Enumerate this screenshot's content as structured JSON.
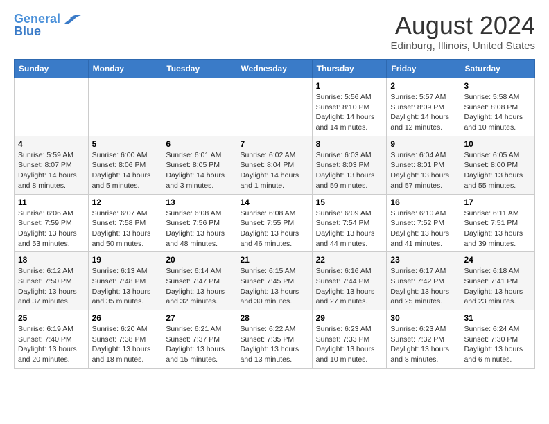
{
  "header": {
    "logo_line1": "General",
    "logo_line2": "Blue",
    "main_title": "August 2024",
    "subtitle": "Edinburg, Illinois, United States"
  },
  "weekdays": [
    "Sunday",
    "Monday",
    "Tuesday",
    "Wednesday",
    "Thursday",
    "Friday",
    "Saturday"
  ],
  "weeks": [
    [
      {
        "day": "",
        "info": ""
      },
      {
        "day": "",
        "info": ""
      },
      {
        "day": "",
        "info": ""
      },
      {
        "day": "",
        "info": ""
      },
      {
        "day": "1",
        "info": "Sunrise: 5:56 AM\nSunset: 8:10 PM\nDaylight: 14 hours\nand 14 minutes."
      },
      {
        "day": "2",
        "info": "Sunrise: 5:57 AM\nSunset: 8:09 PM\nDaylight: 14 hours\nand 12 minutes."
      },
      {
        "day": "3",
        "info": "Sunrise: 5:58 AM\nSunset: 8:08 PM\nDaylight: 14 hours\nand 10 minutes."
      }
    ],
    [
      {
        "day": "4",
        "info": "Sunrise: 5:59 AM\nSunset: 8:07 PM\nDaylight: 14 hours\nand 8 minutes."
      },
      {
        "day": "5",
        "info": "Sunrise: 6:00 AM\nSunset: 8:06 PM\nDaylight: 14 hours\nand 5 minutes."
      },
      {
        "day": "6",
        "info": "Sunrise: 6:01 AM\nSunset: 8:05 PM\nDaylight: 14 hours\nand 3 minutes."
      },
      {
        "day": "7",
        "info": "Sunrise: 6:02 AM\nSunset: 8:04 PM\nDaylight: 14 hours\nand 1 minute."
      },
      {
        "day": "8",
        "info": "Sunrise: 6:03 AM\nSunset: 8:03 PM\nDaylight: 13 hours\nand 59 minutes."
      },
      {
        "day": "9",
        "info": "Sunrise: 6:04 AM\nSunset: 8:01 PM\nDaylight: 13 hours\nand 57 minutes."
      },
      {
        "day": "10",
        "info": "Sunrise: 6:05 AM\nSunset: 8:00 PM\nDaylight: 13 hours\nand 55 minutes."
      }
    ],
    [
      {
        "day": "11",
        "info": "Sunrise: 6:06 AM\nSunset: 7:59 PM\nDaylight: 13 hours\nand 53 minutes."
      },
      {
        "day": "12",
        "info": "Sunrise: 6:07 AM\nSunset: 7:58 PM\nDaylight: 13 hours\nand 50 minutes."
      },
      {
        "day": "13",
        "info": "Sunrise: 6:08 AM\nSunset: 7:56 PM\nDaylight: 13 hours\nand 48 minutes."
      },
      {
        "day": "14",
        "info": "Sunrise: 6:08 AM\nSunset: 7:55 PM\nDaylight: 13 hours\nand 46 minutes."
      },
      {
        "day": "15",
        "info": "Sunrise: 6:09 AM\nSunset: 7:54 PM\nDaylight: 13 hours\nand 44 minutes."
      },
      {
        "day": "16",
        "info": "Sunrise: 6:10 AM\nSunset: 7:52 PM\nDaylight: 13 hours\nand 41 minutes."
      },
      {
        "day": "17",
        "info": "Sunrise: 6:11 AM\nSunset: 7:51 PM\nDaylight: 13 hours\nand 39 minutes."
      }
    ],
    [
      {
        "day": "18",
        "info": "Sunrise: 6:12 AM\nSunset: 7:50 PM\nDaylight: 13 hours\nand 37 minutes."
      },
      {
        "day": "19",
        "info": "Sunrise: 6:13 AM\nSunset: 7:48 PM\nDaylight: 13 hours\nand 35 minutes."
      },
      {
        "day": "20",
        "info": "Sunrise: 6:14 AM\nSunset: 7:47 PM\nDaylight: 13 hours\nand 32 minutes."
      },
      {
        "day": "21",
        "info": "Sunrise: 6:15 AM\nSunset: 7:45 PM\nDaylight: 13 hours\nand 30 minutes."
      },
      {
        "day": "22",
        "info": "Sunrise: 6:16 AM\nSunset: 7:44 PM\nDaylight: 13 hours\nand 27 minutes."
      },
      {
        "day": "23",
        "info": "Sunrise: 6:17 AM\nSunset: 7:42 PM\nDaylight: 13 hours\nand 25 minutes."
      },
      {
        "day": "24",
        "info": "Sunrise: 6:18 AM\nSunset: 7:41 PM\nDaylight: 13 hours\nand 23 minutes."
      }
    ],
    [
      {
        "day": "25",
        "info": "Sunrise: 6:19 AM\nSunset: 7:40 PM\nDaylight: 13 hours\nand 20 minutes."
      },
      {
        "day": "26",
        "info": "Sunrise: 6:20 AM\nSunset: 7:38 PM\nDaylight: 13 hours\nand 18 minutes."
      },
      {
        "day": "27",
        "info": "Sunrise: 6:21 AM\nSunset: 7:37 PM\nDaylight: 13 hours\nand 15 minutes."
      },
      {
        "day": "28",
        "info": "Sunrise: 6:22 AM\nSunset: 7:35 PM\nDaylight: 13 hours\nand 13 minutes."
      },
      {
        "day": "29",
        "info": "Sunrise: 6:23 AM\nSunset: 7:33 PM\nDaylight: 13 hours\nand 10 minutes."
      },
      {
        "day": "30",
        "info": "Sunrise: 6:23 AM\nSunset: 7:32 PM\nDaylight: 13 hours\nand 8 minutes."
      },
      {
        "day": "31",
        "info": "Sunrise: 6:24 AM\nSunset: 7:30 PM\nDaylight: 13 hours\nand 6 minutes."
      }
    ]
  ]
}
